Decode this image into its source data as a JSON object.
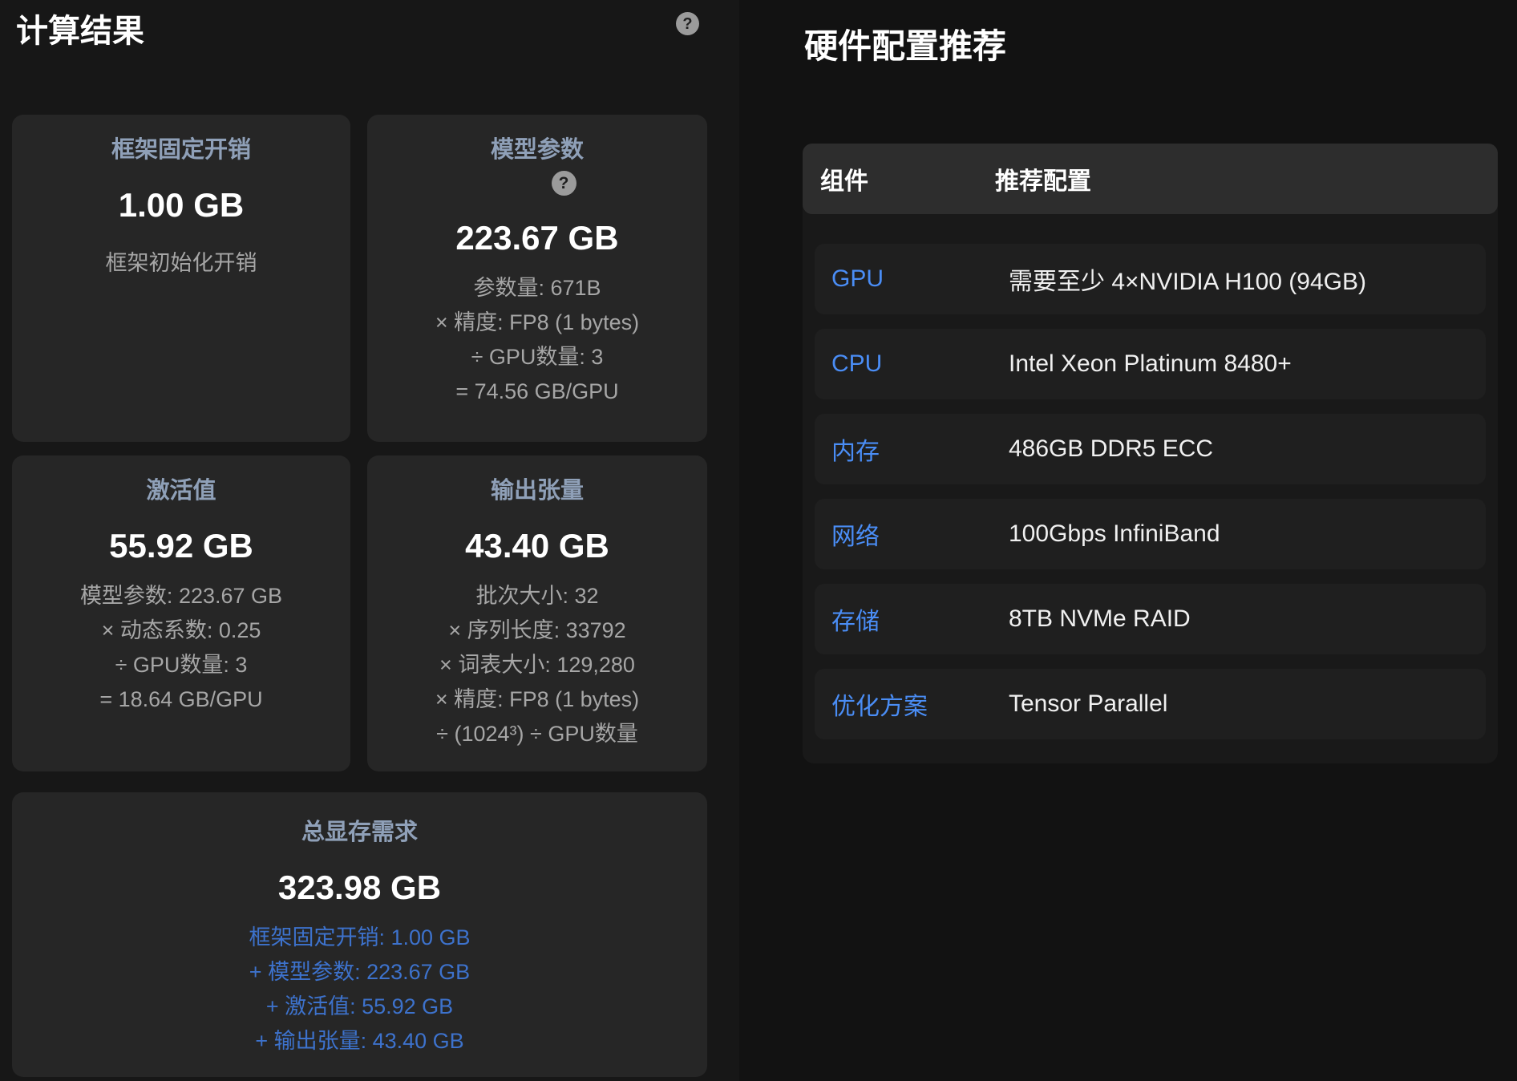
{
  "left_panel": {
    "title": "计算结果",
    "cards": [
      {
        "title": "框架固定开销",
        "value": "1.00 GB",
        "lines": [
          "框架初始化开销"
        ]
      },
      {
        "title": "模型参数",
        "value": "223.67 GB",
        "lines": [
          "参数量: 671B",
          "× 精度: FP8 (1 bytes)",
          "÷ GPU数量: 3",
          "= 74.56 GB/GPU"
        ]
      },
      {
        "title": "激活值",
        "value": "55.92 GB",
        "lines": [
          "模型参数: 223.67 GB",
          "× 动态系数: 0.25",
          "÷ GPU数量: 3",
          "= 18.64 GB/GPU"
        ]
      },
      {
        "title": "输出张量",
        "value": "43.40 GB",
        "lines": [
          "批次大小: 32",
          "× 序列长度: 33792",
          "× 词表大小: 129,280",
          "× 精度: FP8 (1 bytes)",
          "÷ (1024³) ÷ GPU数量"
        ]
      }
    ],
    "total_card": {
      "title": "总显存需求",
      "value": "323.98 GB",
      "breakdown": [
        "框架固定开销: 1.00 GB",
        "+ 模型参数: 223.67 GB",
        "+ 激活值: 55.92 GB",
        "+ 输出张量: 43.40 GB"
      ]
    }
  },
  "right_panel": {
    "title": "硬件配置推荐",
    "table": {
      "headers": [
        "组件",
        "推荐配置"
      ],
      "rows": [
        {
          "label": "GPU",
          "value": "需要至少 4×NVIDIA H100 (94GB)"
        },
        {
          "label": "CPU",
          "value": "Intel Xeon Platinum 8480+"
        },
        {
          "label": "内存",
          "value": "486GB DDR5 ECC"
        },
        {
          "label": "网络",
          "value": "100Gbps InfiniBand"
        },
        {
          "label": "存储",
          "value": "8TB NVMe RAID"
        },
        {
          "label": "优化方案",
          "value": "Tensor Parallel"
        }
      ]
    }
  },
  "icons": {
    "help_glyph": "?"
  },
  "colors": {
    "accent_blue": "#4a8df5",
    "breakdown_blue": "#3d72cc",
    "card_title_slate": "#8fa0b8",
    "card_bg": "#262626",
    "row_bg": "#1f1f1f",
    "table_header_bg": "#2d2d2d",
    "left_panel_bg": "#171717",
    "page_bg": "#121212"
  }
}
